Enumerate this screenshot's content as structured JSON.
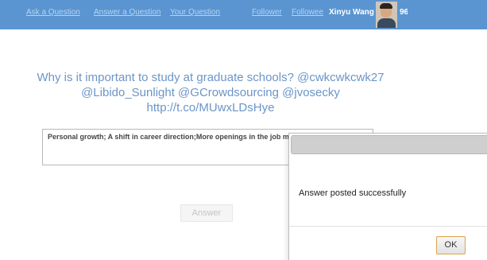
{
  "nav": {
    "links": [
      {
        "label": "Ask a Question"
      },
      {
        "label": "Answer a Question"
      },
      {
        "label": "Your Question"
      },
      {
        "label": "Follower"
      },
      {
        "label": "Followee"
      }
    ],
    "user_name": "Xinyu Wang",
    "score": "96"
  },
  "question": {
    "line1": "Why is it important to study at graduate schools? @cwkcwkcwk27",
    "line2": "@Libido_Sunlight @GCrowdsourcing @jvosecky",
    "line3": "http://t.co/MUwxLDsHye"
  },
  "answer": {
    "text": "Personal growth; A shift in career direction;More openings in the job market.",
    "button_label": "Answer"
  },
  "dialog": {
    "title": "",
    "message": "Answer posted successfully",
    "ok_label": "OK"
  },
  "colors": {
    "navbar": "#5a95d2",
    "question_text": "#6b95c7",
    "ok_border": "#d9a64a"
  }
}
